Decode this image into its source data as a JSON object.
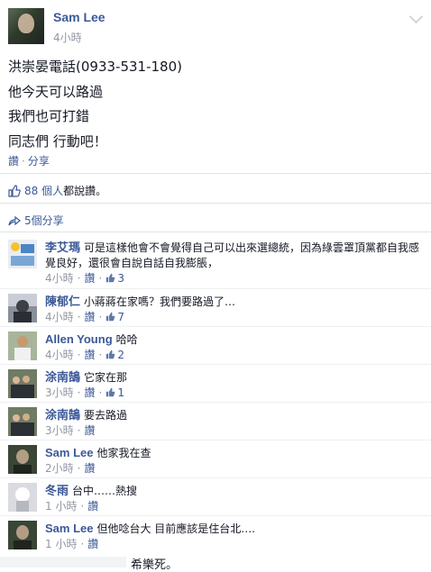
{
  "post": {
    "author": "Sam Lee",
    "time": "4小時",
    "lines": [
      "洪崇晏電話(0933-531-180)",
      "他今天可以路過",
      "我們也可打錯",
      "同志們 行動吧！"
    ],
    "like_label": "讚",
    "share_label": "分享"
  },
  "summary": {
    "like_count": "88 個人",
    "like_suffix": "都說讚。",
    "shares": "5個分享"
  },
  "comments": [
    {
      "name": "李艾瑪",
      "text": "可是這樣他會不會覺得自己可以出來選總統，因為綠雲罩頂黨都自我感覺良好，還很會自說自話自我膨脹，",
      "time": "4小時",
      "like_label": "讚",
      "likes": "3"
    },
    {
      "name": "陳郁仁",
      "text": "小蔣蔣在家嗎？我們要路過了…",
      "time": "4小時",
      "like_label": "讚",
      "likes": "7"
    },
    {
      "name": "Allen Young",
      "text": "哈哈",
      "time": "4小時",
      "like_label": "讚",
      "likes": "2"
    },
    {
      "name": "涂南鵠",
      "text": "它家在那",
      "time": "3小時",
      "like_label": "讚",
      "likes": "1"
    },
    {
      "name": "涂南鵠",
      "text": "要去路過",
      "time": "3小時",
      "like_label": "讚",
      "likes": ""
    },
    {
      "name": "Sam Lee",
      "text": "他家我在查",
      "time": "2小時",
      "like_label": "讚",
      "likes": ""
    },
    {
      "name": "冬雨",
      "text": "台中……熱搜",
      "time": "1 小時",
      "like_label": "讚",
      "likes": ""
    },
    {
      "name": "Sam Lee",
      "text": "但他唸台大 目前應該是住台北….",
      "time": "1 小時",
      "like_label": "讚",
      "likes": ""
    }
  ],
  "cutoff_text": "希樂死。",
  "colors": {
    "link": "#3b5998",
    "muted": "#9197a3",
    "text": "#141823",
    "divider": "#e1e2e3"
  },
  "icons": [
    "chevron-down-icon",
    "thumbs-up-icon",
    "share-arrow-icon"
  ]
}
